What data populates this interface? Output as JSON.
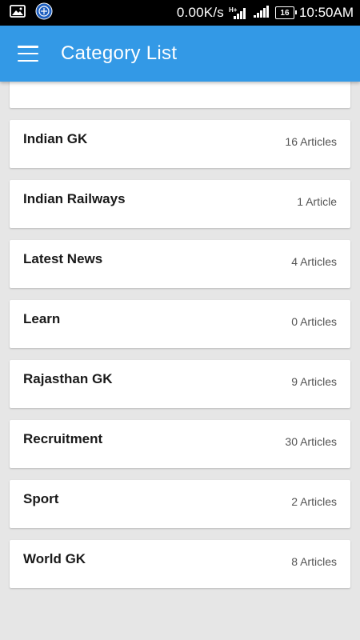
{
  "status_bar": {
    "network_speed": "0.00K/s",
    "network_type": "H+",
    "battery_level": "16",
    "time": "10:50AM"
  },
  "app_bar": {
    "title": "Category List",
    "color": "#3399e6"
  },
  "categories": [
    {
      "name": "Indian GK",
      "count": "16 Articles"
    },
    {
      "name": "Indian Railways",
      "count": "1 Article"
    },
    {
      "name": "Latest News",
      "count": "4 Articles"
    },
    {
      "name": "Learn",
      "count": "0 Articles"
    },
    {
      "name": "Rajasthan GK",
      "count": "9 Articles"
    },
    {
      "name": "Recruitment",
      "count": "30 Articles"
    },
    {
      "name": "Sport",
      "count": "2 Articles"
    },
    {
      "name": "World GK",
      "count": "8 Articles"
    }
  ]
}
